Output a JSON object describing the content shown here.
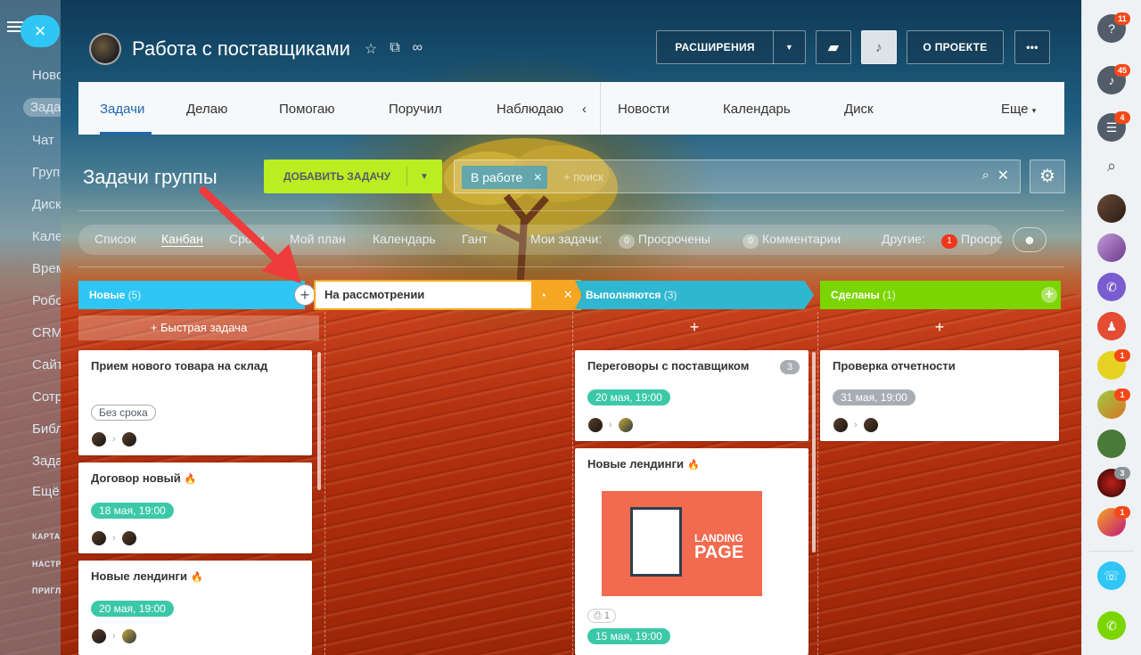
{
  "left_menu": {
    "items": [
      "Ново",
      "Зада",
      "Чат",
      "Груп",
      "Диск",
      "Кале",
      "Врем",
      "Робо",
      "CRM",
      "Сайт",
      "Сотр",
      "Библ",
      "Зада",
      "Ещё"
    ],
    "sections": [
      "КАРТА",
      "НАСТР",
      "ПРИГЛ"
    ],
    "close": "×"
  },
  "header": {
    "title": "Работа с поставщиками",
    "extensions_label": "РАСШИРЕНИЯ",
    "about_label": "О ПРОЕКТЕ",
    "more": "•••"
  },
  "topnav": {
    "items": [
      "Задачи",
      "Делаю",
      "Помогаю",
      "Поручил",
      "Наблюдаю",
      "Новости",
      "Календарь",
      "Диск",
      "Еще"
    ],
    "collapse": "‹"
  },
  "toolbar": {
    "section_title": "Задачи группы",
    "add_task_label": "ДОБАВИТЬ ЗАДАЧУ",
    "filter_chip": "В работе",
    "search_placeholder": "+ поиск"
  },
  "views": {
    "list": "Список",
    "kanban": "Канбан",
    "deadlines": "Сроки",
    "my_plan": "Мой план",
    "calendar": "Календарь",
    "gantt": "Гант",
    "my_tasks": "Мои задачи:",
    "overdue_count": "0",
    "overdue": "Просрочены",
    "comments_count": "0",
    "comments": "Комментарии",
    "others": "Другие:",
    "others_count": "1",
    "others_overdue": "Просро"
  },
  "kanban": {
    "quick_task": "+ Быстрая задача",
    "new_column_value": "На рассмотрении",
    "columns": [
      {
        "name": "Новые",
        "count": "(5)",
        "color": "#2fc6f6"
      },
      {
        "name": "Выполняются",
        "count": "(3)",
        "color": "#2fb7d0"
      },
      {
        "name": "Сделаны",
        "count": "(1)",
        "color": "#7bd500"
      }
    ],
    "cards_new": [
      {
        "title": "Прием нового товара на склад",
        "deadline": "Без срока"
      },
      {
        "title": "Договор новый",
        "deadline": "18 мая, 19:00"
      },
      {
        "title": "Новые лендинги",
        "deadline": "20 мая, 19:00"
      }
    ],
    "cards_progress": [
      {
        "title": "Переговоры с поставщиком",
        "deadline": "20 мая, 19:00",
        "comments": "3"
      },
      {
        "title": "Новые лендинги",
        "deadline": "15 мая, 19:00",
        "attachments": "1",
        "image_text_1": "LANDING",
        "image_text_2": "PAGE"
      }
    ],
    "cards_done": [
      {
        "title": "Проверка отчетности",
        "deadline": "31 мая, 19:00"
      }
    ]
  },
  "right_panel": {
    "badges": [
      "11",
      "45",
      "4",
      "1",
      "1",
      "3",
      "1"
    ]
  }
}
